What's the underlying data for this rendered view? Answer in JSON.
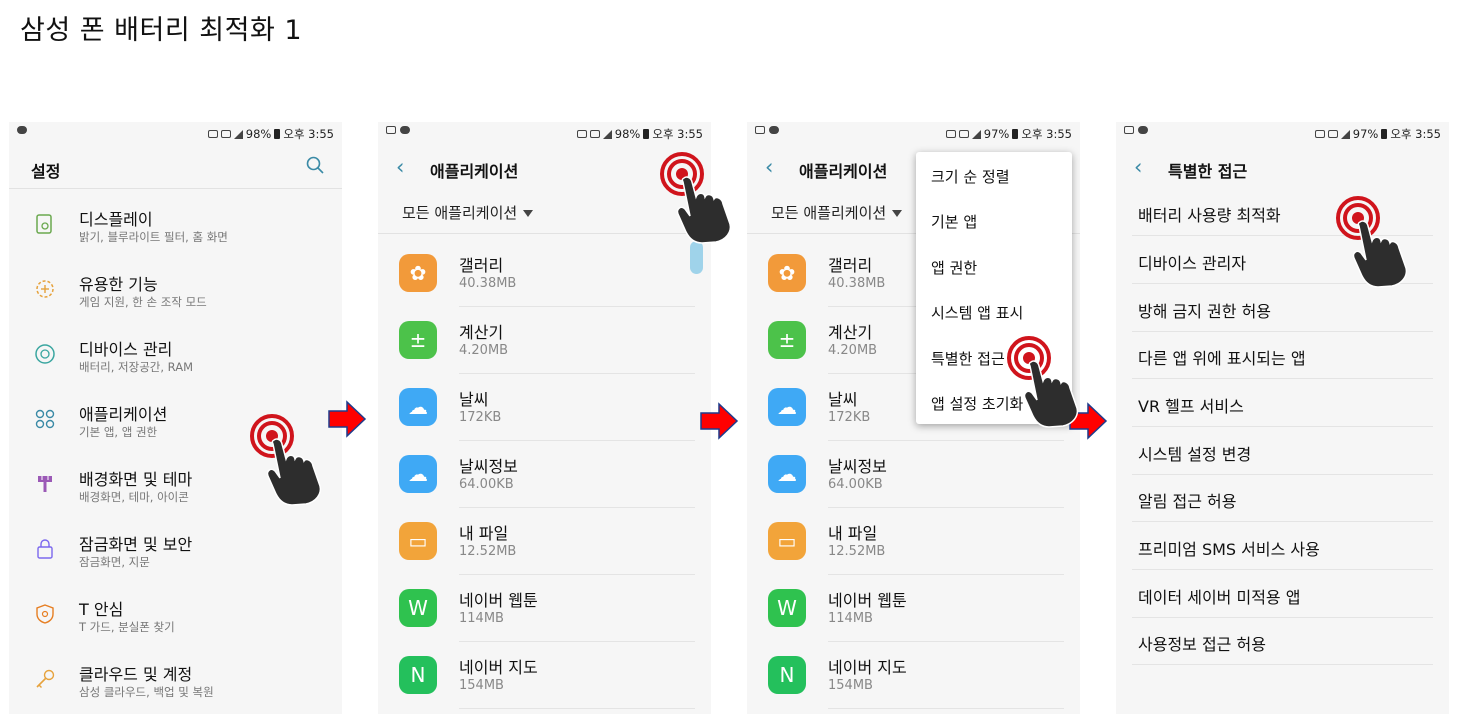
{
  "page_title": "삼성 폰 배터리 최적화 1",
  "colors": {
    "accent": "#3a8aa6",
    "arrow_red": "#ff0000",
    "arrow_outline": "#1f3b8c",
    "tap_red": "#d0141c"
  },
  "screen1": {
    "status": {
      "battery": "98%",
      "time": "오후 3:55"
    },
    "header_title": "설정",
    "items": [
      {
        "title": "디스플레이",
        "sub": "밝기, 블루라이트 필터, 홈 화면",
        "icon": "display-icon"
      },
      {
        "title": "유용한 기능",
        "sub": "게임 지원, 한 손 조작 모드",
        "icon": "gear-plus-icon"
      },
      {
        "title": "디바이스 관리",
        "sub": "배터리, 저장공간, RAM",
        "icon": "device-care-icon"
      },
      {
        "title": "애플리케이션",
        "sub": "기본 앱, 앱 권한",
        "icon": "apps-icon"
      },
      {
        "title": "배경화면 및 테마",
        "sub": "배경화면, 테마, 아이콘",
        "icon": "brush-icon"
      },
      {
        "title": "잠금화면 및 보안",
        "sub": "잠금화면, 지문",
        "icon": "lock-icon"
      },
      {
        "title": "T 안심",
        "sub": "T 가드, 분실폰 찾기",
        "icon": "shield-icon"
      },
      {
        "title": "클라우드 및 계정",
        "sub": "삼성 클라우드, 백업 및 복원",
        "icon": "key-icon"
      }
    ]
  },
  "screen2": {
    "status": {
      "battery": "98%",
      "time": "오후 3:55"
    },
    "header_title": "애플리케이션",
    "dropdown_label": "모든 애플리케이션",
    "apps": [
      {
        "name": "갤러리",
        "size": "40.38MB",
        "icon": "gallery-icon",
        "color": "#f29a3a"
      },
      {
        "name": "계산기",
        "size": "4.20MB",
        "icon": "calculator-icon",
        "color": "#4cc24a"
      },
      {
        "name": "날씨",
        "size": "172KB",
        "icon": "weather-icon",
        "color": "#3fa9f5"
      },
      {
        "name": "날씨정보",
        "size": "64.00KB",
        "icon": "weather-info-icon",
        "color": "#3fa9f5"
      },
      {
        "name": "내 파일",
        "size": "12.52MB",
        "icon": "folder-icon",
        "color": "#f2a43a"
      },
      {
        "name": "네이버 웹툰",
        "size": "114MB",
        "icon": "webtoon-icon",
        "color": "#2fc24f"
      },
      {
        "name": "네이버 지도",
        "size": "154MB",
        "icon": "naver-map-icon",
        "color": "#24c05c"
      }
    ]
  },
  "screen3": {
    "status": {
      "battery": "97%",
      "time": "오후 3:55"
    },
    "header_title": "애플리케이션",
    "dropdown_label": "모든 애플리케이션",
    "menu_items": [
      "크기 순 정렬",
      "기본 앱",
      "앱 권한",
      "시스템 앱 표시",
      "특별한 접근",
      "앱 설정 초기화"
    ],
    "apps": [
      {
        "name": "갤러리",
        "size": "40.38MB"
      },
      {
        "name": "계산기",
        "size": "4.20MB"
      },
      {
        "name": "날씨",
        "size": "172KB"
      },
      {
        "name": "날씨정보",
        "size": "64.00KB"
      },
      {
        "name": "내 파일",
        "size": "12.52MB"
      },
      {
        "name": "네이버 웹툰",
        "size": "114MB"
      },
      {
        "name": "네이버 지도",
        "size": "154MB"
      }
    ]
  },
  "screen4": {
    "status": {
      "battery": "97%",
      "time": "오후 3:55"
    },
    "header_title": "특별한 접근",
    "items": [
      "배터리 사용량 최적화",
      "디바이스 관리자",
      "방해 금지 권한 허용",
      "다른 앱 위에 표시되는 앱",
      "VR 헬프 서비스",
      "시스템 설정 변경",
      "알림 접근 허용",
      "프리미엄 SMS 서비스 사용",
      "데이터 세이버 미적용 앱",
      "사용정보 접근 허용"
    ]
  }
}
